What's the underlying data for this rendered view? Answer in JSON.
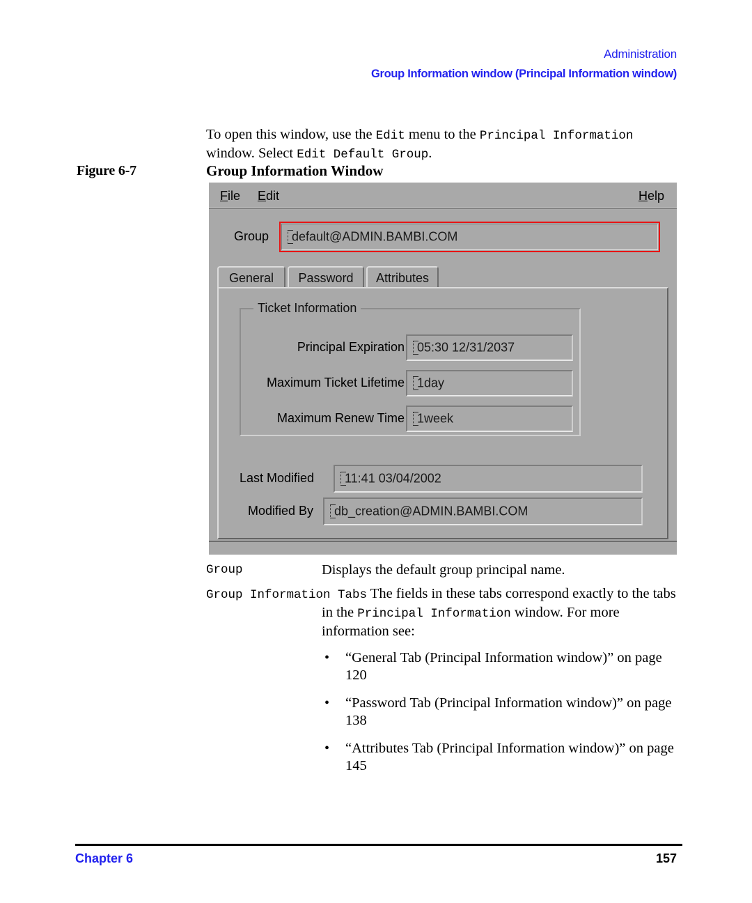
{
  "header": {
    "running_head": "Administration",
    "section_title": "Group Information window (Principal Information window)",
    "accent_color": "#2222ee"
  },
  "intro": {
    "part1": "To open this window, use the ",
    "code1": "Edit",
    "part2": " menu to the ",
    "code2": "Principal Information",
    "part3": " window. Select ",
    "code3": "Edit Default Group",
    "part4": "."
  },
  "figure": {
    "label": "Figure 6-7",
    "title": "Group Information Window"
  },
  "dialog": {
    "menu": {
      "file": "File",
      "file_mnemonic": "F",
      "file_rest": "ile",
      "edit": "Edit",
      "edit_mnemonic": "E",
      "edit_rest": "dit",
      "help": "Help",
      "help_mnemonic": "H",
      "help_rest": "elp"
    },
    "group": {
      "label": "Group",
      "value": "default@ADMIN.BAMBI.COM",
      "highlight_color": "#e81414"
    },
    "tabs": [
      {
        "label": "General",
        "active": true
      },
      {
        "label": "Password",
        "active": false
      },
      {
        "label": "Attributes",
        "active": false
      }
    ],
    "ticket_information": {
      "legend": "Ticket Information",
      "fields": [
        {
          "label": "Principal Expiration",
          "value": "05:30  12/31/2037"
        },
        {
          "label": "Maximum Ticket Lifetime",
          "value": "1day"
        },
        {
          "label": "Maximum Renew Time",
          "value": "1week"
        }
      ]
    },
    "audit": [
      {
        "label": "Last Modified",
        "value": "11:41  03/04/2002"
      },
      {
        "label": "Modified By",
        "value": "db_creation@ADMIN.BAMBI.COM"
      }
    ]
  },
  "definitions": {
    "row1": {
      "term": "Group",
      "definition": "Displays the default group principal name."
    },
    "row2": {
      "term": "Group Information Tabs",
      "text1": " The fields in these tabs correspond exactly to the tabs in the ",
      "code1": "Principal Information",
      "text2": " window. For more information see:"
    }
  },
  "bullets": [
    {
      "marker": "•",
      "text": "“General Tab (Principal Information window)” on page 120"
    },
    {
      "marker": "•",
      "text": "“Password Tab (Principal Information window)” on page 138"
    },
    {
      "marker": "•",
      "text": "“Attributes Tab (Principal Information window)” on page 145"
    }
  ],
  "footer": {
    "chapter": "Chapter 6",
    "page_number": "157"
  }
}
